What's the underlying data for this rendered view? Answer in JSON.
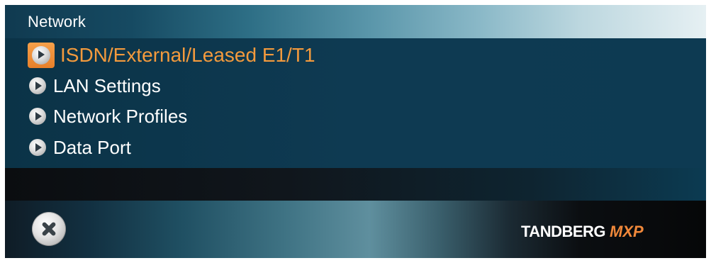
{
  "window": {
    "title": "Network"
  },
  "menu": {
    "items": [
      {
        "label": "ISDN/External/Leased E1/T1",
        "selected": true,
        "icon": "play-arrow-icon"
      },
      {
        "label": "LAN Settings",
        "selected": false,
        "icon": "play-arrow-icon"
      },
      {
        "label": "Network Profiles",
        "selected": false,
        "icon": "play-arrow-icon"
      },
      {
        "label": "Data Port",
        "selected": false,
        "icon": "play-arrow-icon"
      }
    ]
  },
  "footer": {
    "close_icon": "close-icon",
    "logo": {
      "brand": "TANDBERG",
      "product": "MXP"
    }
  },
  "colors": {
    "accent": "#f39a3d",
    "selection_box": "#e8802a",
    "menu_background": "#0e3a52",
    "text": "#ffffff"
  }
}
